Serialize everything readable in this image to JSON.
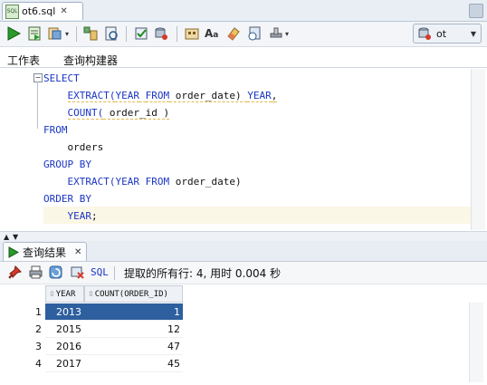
{
  "file_tab": {
    "label": "ot6.sql",
    "icon": "sql-file-icon"
  },
  "toolbar": {
    "icons": [
      "run-statement-icon",
      "run-script-icon",
      "commit-icon",
      "explain-plan-icon",
      "autotrace-icon",
      "sql-tuning-icon",
      "rollback-icon",
      "clear-icon",
      "history-icon",
      "find-icon",
      "format-icon",
      "eraser-icon",
      "sql-history-icon",
      "tools-icon"
    ],
    "connection": "ot"
  },
  "worksheet_tabs": {
    "worksheet": "工作表",
    "query_builder": "查询构建器"
  },
  "editor": {
    "lines": [
      [
        {
          "t": "SELECT",
          "c": "kw"
        }
      ],
      [
        {
          "t": "    "
        },
        {
          "t": "EXTRACT(",
          "c": "kw"
        },
        {
          "t": "YEAR",
          "c": "kw"
        },
        {
          "t": " "
        },
        {
          "t": "FROM",
          "c": "kw"
        },
        {
          "t": " order_date) ",
          "c": "id"
        },
        {
          "t": "YEAR",
          "c": "kw"
        },
        {
          "t": ",",
          "c": "id"
        }
      ],
      [
        {
          "t": "    "
        },
        {
          "t": "COUNT(",
          "c": "kw"
        },
        {
          "t": " order_id )",
          "c": "id"
        }
      ],
      [
        {
          "t": "FROM",
          "c": "kw"
        }
      ],
      [
        {
          "t": "    orders",
          "c": "id"
        }
      ],
      [
        {
          "t": "GROUP BY",
          "c": "kw"
        }
      ],
      [
        {
          "t": "    "
        },
        {
          "t": "EXTRACT(",
          "c": "kw"
        },
        {
          "t": "YEAR",
          "c": "kw"
        },
        {
          "t": " "
        },
        {
          "t": "FROM",
          "c": "kw"
        },
        {
          "t": " order_date)",
          "c": "id"
        }
      ],
      [
        {
          "t": "ORDER BY",
          "c": "kw"
        }
      ],
      [
        {
          "t": "    "
        },
        {
          "t": "YEAR",
          "c": "kw"
        },
        {
          "t": ";",
          "c": "id"
        }
      ]
    ]
  },
  "results": {
    "tab_label": "查询结果",
    "sql_link": "SQL",
    "status": "提取的所有行: 4, 用时 0.004 秒",
    "columns": [
      "YEAR",
      "COUNT(ORDER_ID)"
    ],
    "rows": [
      [
        "1",
        "2013",
        "1"
      ],
      [
        "2",
        "2015",
        "12"
      ],
      [
        "3",
        "2016",
        "47"
      ],
      [
        "4",
        "2017",
        "45"
      ]
    ]
  },
  "colors": {
    "keyword": "#1a35c4",
    "selection": "#2e5f9e",
    "current_line": "#fbf7e6"
  }
}
